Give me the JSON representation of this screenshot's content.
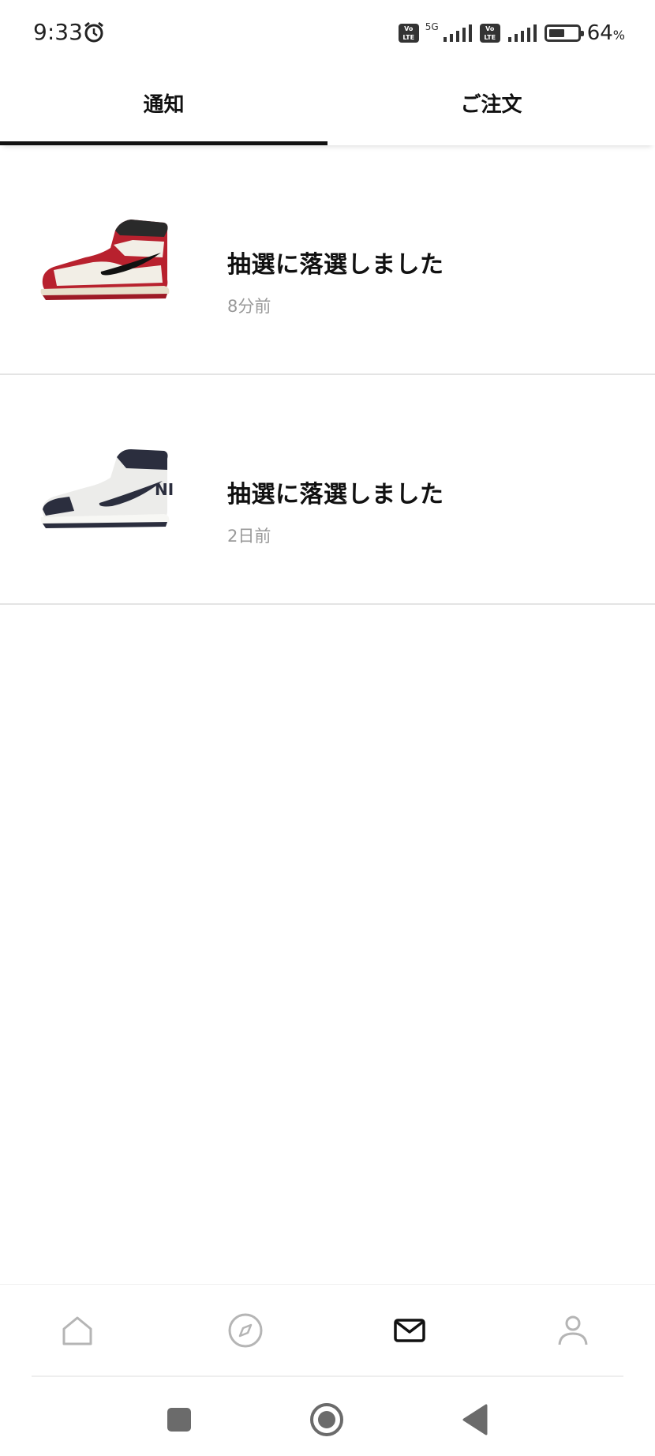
{
  "status_bar": {
    "time": "9:33",
    "network": "5G",
    "volte_1": "Vo LTE",
    "volte_2": "Vo LTE",
    "battery_percent": 64,
    "battery_label": "64",
    "battery_unit": "%"
  },
  "tabs": [
    {
      "label": "通知",
      "active": true
    },
    {
      "label": "ご注文",
      "active": false
    }
  ],
  "notifications": [
    {
      "title": "抽選に落選しました",
      "time": "8分前",
      "thumbnail_icon": "sneaker-red-white-icon"
    },
    {
      "title": "抽選に落選しました",
      "time": "2日前",
      "thumbnail_icon": "sneaker-navy-white-icon"
    }
  ],
  "bottom_nav": [
    {
      "icon": "home-icon",
      "active": false
    },
    {
      "icon": "compass-icon",
      "active": false
    },
    {
      "icon": "mail-icon",
      "active": true
    },
    {
      "icon": "profile-icon",
      "active": false
    }
  ],
  "system_nav": [
    "recents-icon",
    "home-circle-icon",
    "back-icon"
  ],
  "colors": {
    "active": "#111111",
    "inactive": "#b5b5b5",
    "muted_text": "#999999",
    "divider": "#e4e4e4"
  }
}
